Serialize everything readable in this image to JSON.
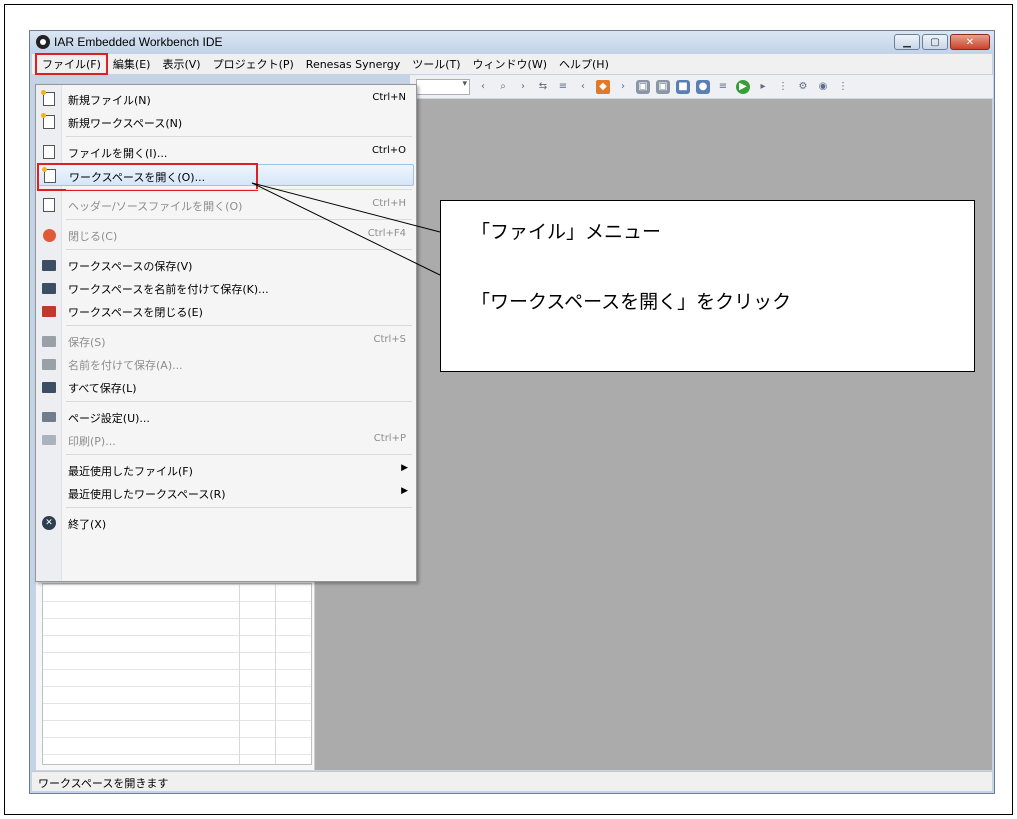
{
  "window": {
    "title": "IAR Embedded Workbench IDE"
  },
  "menubar": [
    {
      "id": "file",
      "label": "ファイル(F)"
    },
    {
      "id": "edit",
      "label": "編集(E)"
    },
    {
      "id": "view",
      "label": "表示(V)"
    },
    {
      "id": "project",
      "label": "プロジェクト(P)"
    },
    {
      "id": "synergy",
      "label": "Renesas Synergy"
    },
    {
      "id": "tools",
      "label": "ツール(T)"
    },
    {
      "id": "window",
      "label": "ウィンドウ(W)"
    },
    {
      "id": "help",
      "label": "ヘルプ(H)"
    }
  ],
  "file_menu": [
    {
      "label": "新規ファイル(N)",
      "shortcut": "Ctrl+N",
      "icon": "new-file-icon"
    },
    {
      "label": "新規ワークスペース(N)",
      "shortcut": "",
      "icon": "new-workspace-icon"
    },
    {
      "label": "ファイルを開く(I)...",
      "shortcut": "Ctrl+O",
      "icon": "open-file-icon"
    },
    {
      "label": "ワークスペースを開く(O)...",
      "shortcut": "",
      "icon": "open-workspace-icon"
    },
    {
      "label": "ヘッダー/ソースファイルを開く(O)",
      "shortcut": "Ctrl+H",
      "icon": "header-source-icon"
    },
    {
      "label": "閉じる(C)",
      "shortcut": "Ctrl+F4",
      "icon": "close-file-icon"
    },
    {
      "label": "ワークスペースの保存(V)",
      "shortcut": "",
      "icon": "save-workspace-icon"
    },
    {
      "label": "ワークスペースを名前を付けて保存(K)...",
      "shortcut": "",
      "icon": "save-workspace-as-icon"
    },
    {
      "label": "ワークスペースを閉じる(E)",
      "shortcut": "",
      "icon": "close-workspace-icon"
    },
    {
      "label": "保存(S)",
      "shortcut": "Ctrl+S",
      "icon": "save-icon"
    },
    {
      "label": "名前を付けて保存(A)...",
      "shortcut": "",
      "icon": "save-as-icon"
    },
    {
      "label": "すべて保存(L)",
      "shortcut": "",
      "icon": "save-all-icon"
    },
    {
      "label": "ページ設定(U)...",
      "shortcut": "",
      "icon": "page-setup-icon"
    },
    {
      "label": "印刷(P)...",
      "shortcut": "Ctrl+P",
      "icon": "print-icon"
    },
    {
      "label": "最近使用したファイル(F)",
      "shortcut": "",
      "icon": ""
    },
    {
      "label": "最近使用したワークスペース(R)",
      "shortcut": "",
      "icon": ""
    },
    {
      "label": "終了(X)",
      "shortcut": "",
      "icon": "exit-icon"
    }
  ],
  "status": {
    "text": "ワークスペースを開きます"
  },
  "callout": {
    "line1": "「ファイル」メニュー",
    "line2": "「ワークスペースを開く」をクリック"
  },
  "colors": {
    "highlight_border": "#e02020",
    "workspace_bg": "#ababab"
  }
}
